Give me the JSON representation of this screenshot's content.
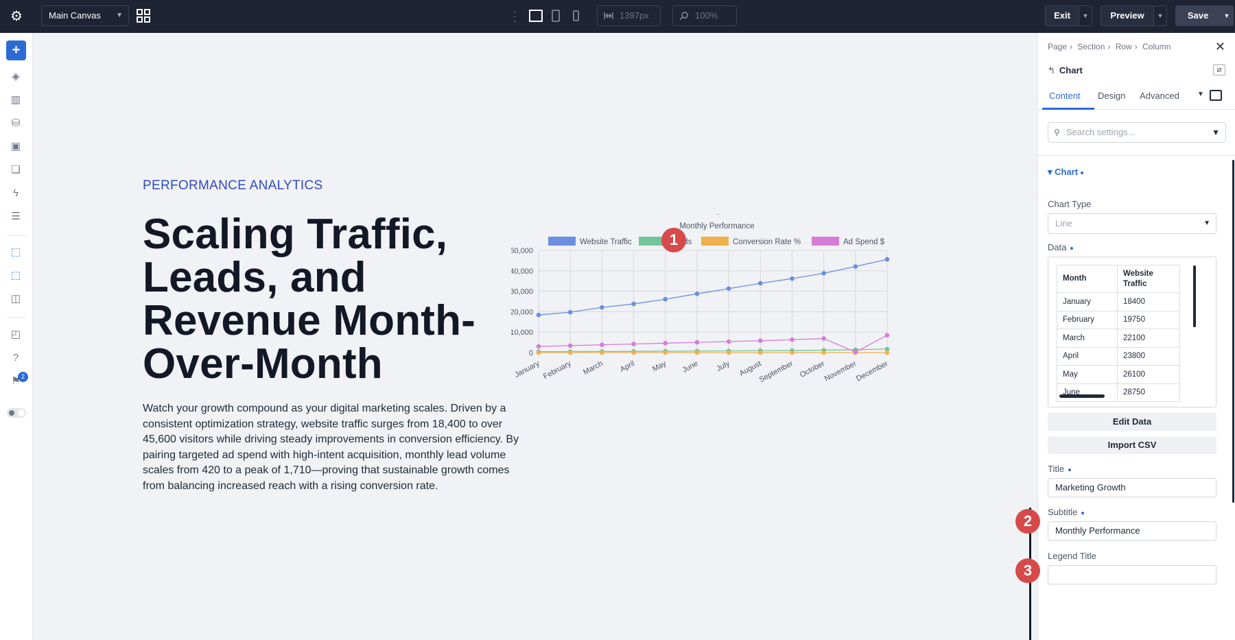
{
  "topbar": {
    "canvas_select": "Main Canvas",
    "width_value": "1397px",
    "zoom_value": "100%",
    "exit_label": "Exit",
    "preview_label": "Preview",
    "save_label": "Save"
  },
  "sidebar": {
    "notification_count": "2"
  },
  "hero": {
    "eyebrow": "PERFORMANCE ANALYTICS",
    "heading_lines": [
      "Scaling Traffic,",
      "Leads, and",
      "Revenue Month-",
      "Over-Month"
    ],
    "paragraph": "Watch your growth compound as your digital marketing scales. Driven by a consistent optimization strategy, website traffic surges from 18,400 to over 45,600 visitors while driving steady improvements in conversion efficiency. By pairing targeted ad spend with high-intent acquisition, monthly lead volume scales from 420 to a peak of 1,710—proving that sustainable growth comes from balancing increased reach with a rising conversion rate."
  },
  "markers": [
    "1",
    "2",
    "3"
  ],
  "chart_data": {
    "type": "line",
    "title": "Marketing Growth",
    "subtitle": "Monthly Performance",
    "categories": [
      "January",
      "February",
      "March",
      "April",
      "May",
      "June",
      "July",
      "August",
      "September",
      "October",
      "November",
      "December"
    ],
    "ylim": [
      0,
      50000
    ],
    "yticks": [
      "0",
      "10,000",
      "20,000",
      "30,000",
      "40,000",
      "50,000"
    ],
    "grid": true,
    "legend_position": "top",
    "series": [
      {
        "name": "Website Traffic",
        "color": "#6b8fe0",
        "values": [
          18400,
          19750,
          22100,
          23800,
          26100,
          28750,
          31300,
          33900,
          36200,
          38800,
          42100,
          45600
        ]
      },
      {
        "name": "Leads",
        "color": "#72c59a",
        "values": [
          420,
          480,
          540,
          600,
          680,
          760,
          840,
          930,
          1030,
          1150,
          1400,
          1710
        ]
      },
      {
        "name": "Conversion Rate %",
        "color": "#f0b04a",
        "values": [
          2.3,
          2.4,
          2.4,
          2.5,
          2.6,
          2.6,
          2.7,
          2.7,
          2.8,
          3.0,
          3.3,
          3.8
        ]
      },
      {
        "name": "Ad Spend $",
        "color": "#d67dd6",
        "values": [
          3000,
          3400,
          3800,
          4200,
          4600,
          5000,
          5400,
          5800,
          6300,
          6900,
          200,
          8500
        ]
      }
    ]
  },
  "panel": {
    "breadcrumb": [
      "Page",
      "Section",
      "Row",
      "Column"
    ],
    "module_title": "Chart",
    "tabs": [
      "Content",
      "Design",
      "Advanced"
    ],
    "search_placeholder": "Search settings...",
    "group_label": "Chart",
    "chart_type_label": "Chart Type",
    "chart_type_value": "Line",
    "data_label": "Data",
    "data_headers": [
      "Month",
      "Website Traffic"
    ],
    "data_rows": [
      [
        "January",
        "18400"
      ],
      [
        "February",
        "19750"
      ],
      [
        "March",
        "22100"
      ],
      [
        "April",
        "23800"
      ],
      [
        "May",
        "26100"
      ],
      [
        "June",
        "28750"
      ]
    ],
    "edit_data_label": "Edit Data",
    "import_csv_label": "Import CSV",
    "title_label": "Title",
    "title_value": "Marketing Growth",
    "subtitle_label": "Subtitle",
    "subtitle_value": "Monthly Performance",
    "legend_title_label": "Legend Title",
    "legend_title_value": ""
  }
}
